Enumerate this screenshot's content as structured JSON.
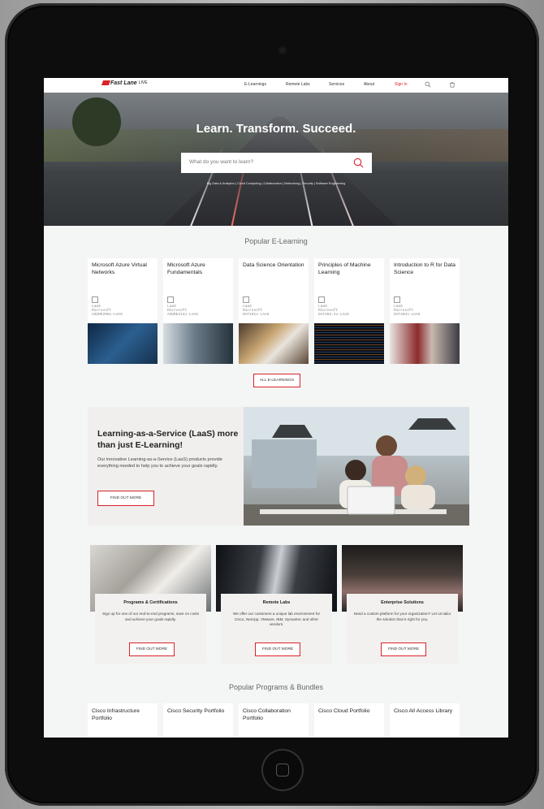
{
  "nav": {
    "logo": "Fast Lane",
    "logo_sub": "LIVE",
    "links": [
      "E-Learnings",
      "Remote Labs",
      "Services",
      "About"
    ],
    "signin": "Sign In"
  },
  "hero": {
    "title": "Learn. Transform. Succeed.",
    "search_placeholder": "What do you want to learn?",
    "tags": "Big Data & Analytics  |  Cloud Computing  |  Collaboration  |  Networking  |  Security  |  Software Engineering"
  },
  "elearning": {
    "title": "Popular E-Learning",
    "cards": [
      {
        "title": "Microsoft Azure Virtual Networks",
        "code1": "LaaS",
        "code2": "Microsoft",
        "code3": "AZURE200x-LAAS"
      },
      {
        "title": "Microsoft Azure Fundamentals",
        "code1": "LaaS",
        "code2": "Microsoft",
        "code3": "AZURE214x-LAAS"
      },
      {
        "title": "Data Science Orientation",
        "code1": "LaaS",
        "code2": "Microsoft",
        "code3": "DAT101x-LAAS"
      },
      {
        "title": "Principles of Machine Learning",
        "code1": "LaaS",
        "code2": "Microsoft",
        "code3": "DAT203.2x-LAAS"
      },
      {
        "title": "Introduction to R for Data Science",
        "code1": "LaaS",
        "code2": "Microsoft",
        "code3": "DAT204x-LAAS"
      }
    ],
    "all_button": "ALL E-LEARNINGS"
  },
  "laas": {
    "heading": "Learning-as-a-Service (LaaS) more than just E-Learning!",
    "body": "Our innovative Learning-as-a-Service (LaaS) products provide everything needed to help you to achieve your goals rapidly.",
    "button": "FIND OUT MORE"
  },
  "tiles": [
    {
      "title": "Programs & Certifications",
      "body": "Sign up for one of our end-to-end programs, save on costs and achieve your goals rapidly.",
      "button": "FIND OUT MORE"
    },
    {
      "title": "Remote Labs",
      "body": "We offer our customers a unique lab environment for Cisco, NetApp, VMware, IBM, Symantec and other vendors.",
      "button": "FIND OUT MORE"
    },
    {
      "title": "Enterprise Solutions",
      "body": "Need a custom platform for your organization? Let us tailor the solution that is right for you.",
      "button": "FIND OUT MORE"
    }
  ],
  "programs": {
    "title": "Popular Programs & Bundles",
    "cards": [
      "Cisco Infrastructure Portfolio",
      "Cisco Security Portfolio",
      "Cisco Collaboration Portfolio",
      "Cisco Cloud Portfolio",
      "Cisco All Access Library"
    ]
  },
  "colors": {
    "accent": "#d8232a",
    "device": "#0d0d0e"
  }
}
